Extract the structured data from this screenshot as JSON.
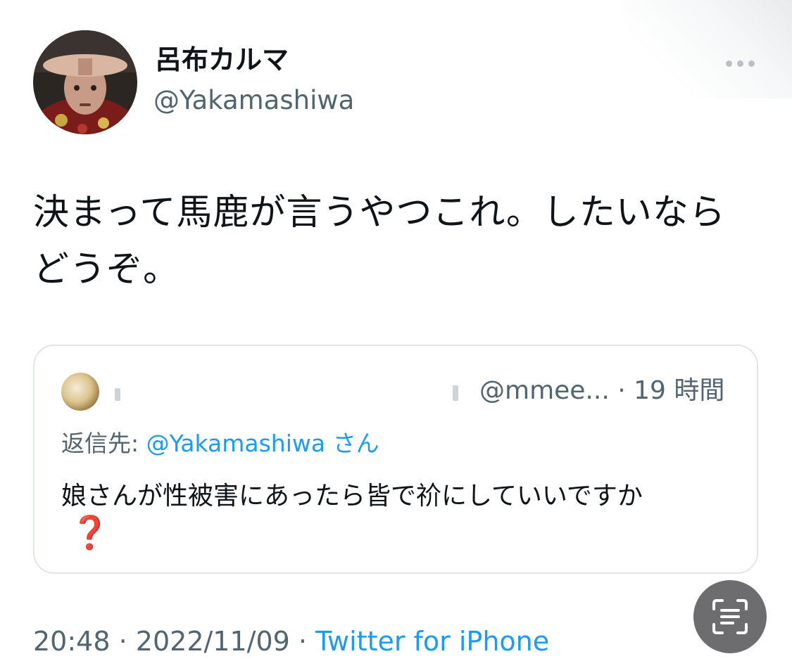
{
  "tweet": {
    "display_name": "呂布カルマ",
    "handle": "@Yakamashiwa",
    "more_icon": "more-horizontal-icon",
    "text": "決まって馬鹿が言うやつこれ。したいならどうぞ。"
  },
  "quoted_tweet": {
    "handle": "@mmee...",
    "separator": "·",
    "time_ago": "19 時間",
    "reply_prefix": "返信先:",
    "reply_to": "@Yakamashiwa",
    "reply_suffix": "さん",
    "text": "娘さんが性被害にあったら皆で祄にしていいですか",
    "emoji": "❓"
  },
  "footer": {
    "time": "20:48",
    "separator": "·",
    "date": "2022/11/09",
    "source": "Twitter for iPhone"
  },
  "overlay": {
    "scan_icon": "live-text-scan-icon"
  },
  "colors": {
    "accent": "#1d9bf0",
    "secondary_text": "#536471",
    "primary_text": "#0f1419",
    "border": "#e2e5e8"
  }
}
